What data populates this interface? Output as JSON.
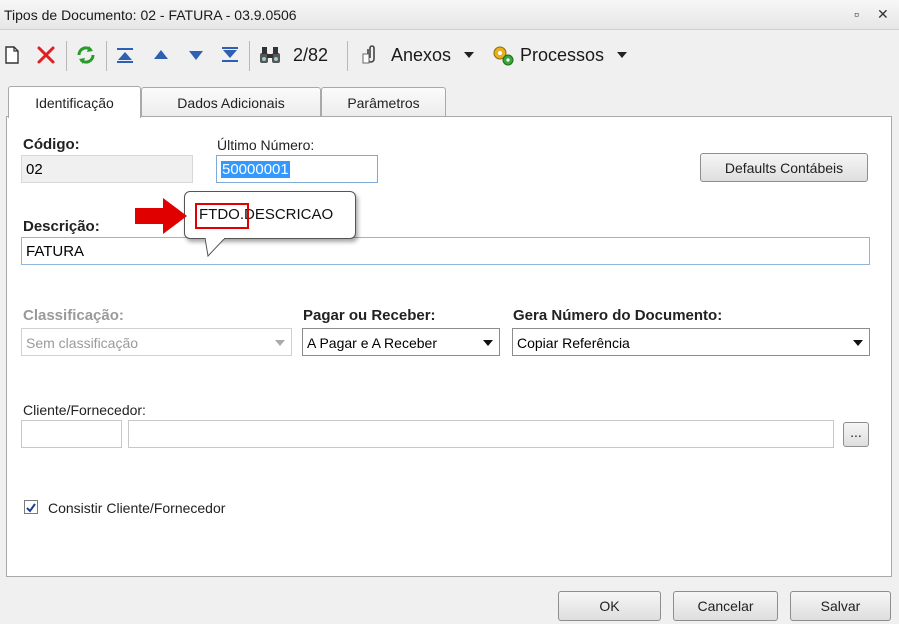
{
  "window": {
    "title": "Tipos de Documento: 02 - FATURA - 03.9.0506",
    "restore_glyph": "▫",
    "close_glyph": "✕"
  },
  "toolbar": {
    "record_counter": "2/82",
    "attachments_label": "Anexos",
    "processes_label": "Processos"
  },
  "tabs": [
    {
      "label": "Identificação",
      "active": true
    },
    {
      "label": "Dados Adicionais",
      "active": false
    },
    {
      "label": "Parâmetros",
      "active": false
    }
  ],
  "form": {
    "codigo_label": "Código:",
    "codigo_value": "02",
    "ultimo_numero_label": "Último Número:",
    "ultimo_numero_value": "50000001",
    "defaults_button": "Defaults Contábeis",
    "descricao_label": "Descrição:",
    "descricao_value": "FATURA",
    "classificacao_label": "Classificação:",
    "classificacao_value": "Sem classificação",
    "pagar_receber_label": "Pagar ou Receber:",
    "pagar_receber_value": "A Pagar e A Receber",
    "gera_numero_label": "Gera Número do Documento:",
    "gera_numero_value": "Copiar Referência",
    "cliente_label": "Cliente/Fornecedor:",
    "cliente_code": "",
    "cliente_name": "",
    "lookup_button": "...",
    "consistir_label": "Consistir Cliente/Fornecedor",
    "consistir_checked": true
  },
  "tooltip": {
    "text": "FTDO.DESCRICAO"
  },
  "footer": {
    "ok": "OK",
    "cancel": "Cancelar",
    "save": "Salvar"
  },
  "colors": {
    "annotation_red": "#e00000",
    "selection_blue": "#3399ff"
  }
}
